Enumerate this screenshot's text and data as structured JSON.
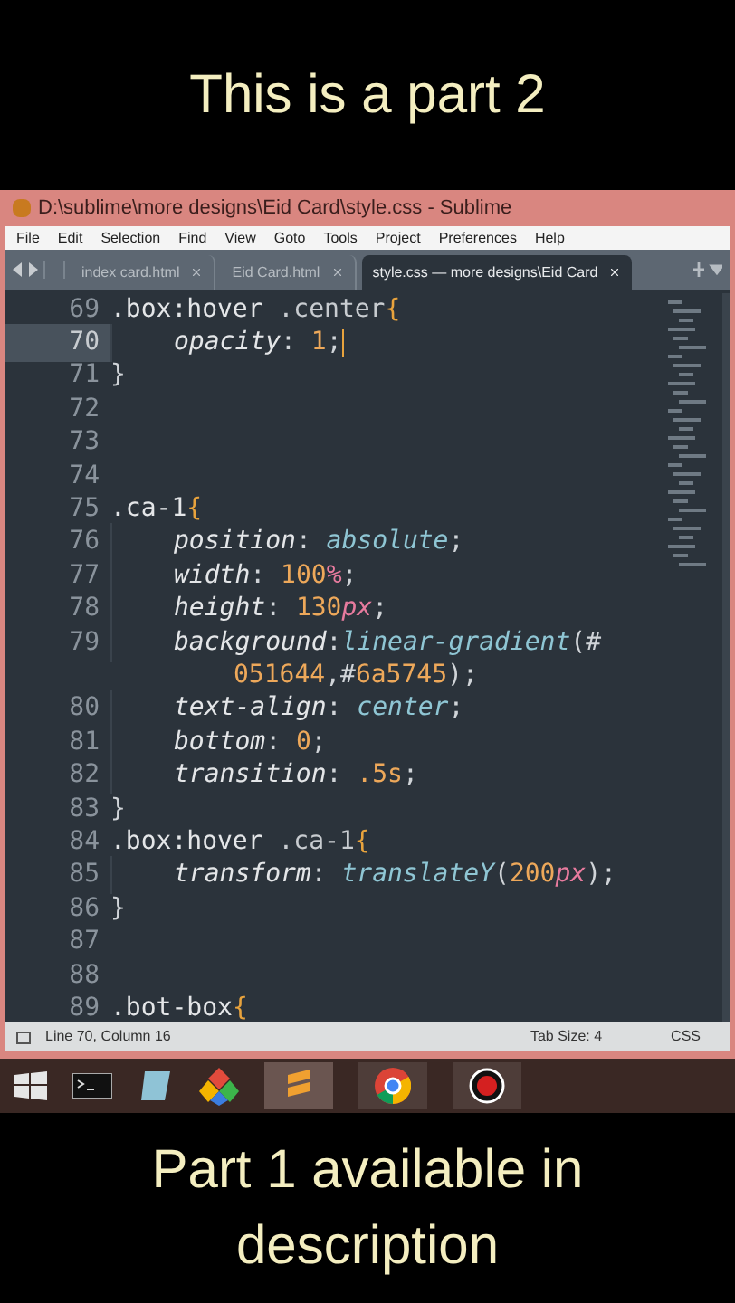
{
  "caption_top": "This is a part 2",
  "window": {
    "title": "D:\\sublime\\more designs\\Eid Card\\style.css - Sublime"
  },
  "menu": [
    "File",
    "Edit",
    "Selection",
    "Find",
    "View",
    "Goto",
    "Tools",
    "Project",
    "Preferences",
    "Help"
  ],
  "tabs": [
    {
      "label": "index card.html",
      "selected": false
    },
    {
      "label": "Eid Card.html",
      "selected": false
    },
    {
      "label": "style.css — more designs\\Eid Card",
      "selected": true
    }
  ],
  "code": [
    {
      "number": "69",
      "current": false,
      "indented": false,
      "segments": [
        {
          "text": ".box",
          "kind": "sel"
        },
        {
          "text": ":hover ",
          "kind": "sel"
        },
        {
          "text": ".center",
          "kind": "sel2"
        },
        {
          "text": "{",
          "kind": "brace"
        }
      ]
    },
    {
      "number": "70",
      "current": true,
      "indented": true,
      "segments": [
        {
          "text": "opacity",
          "kind": "prop"
        },
        {
          "text": ": ",
          "kind": "punct"
        },
        {
          "text": "1",
          "kind": "num"
        },
        {
          "text": ";",
          "kind": "punct"
        }
      ]
    },
    {
      "number": "71",
      "current": false,
      "indented": false,
      "segments": [
        {
          "text": "}",
          "kind": "punct"
        }
      ]
    },
    {
      "number": "72",
      "current": false
    },
    {
      "number": "73",
      "current": false
    },
    {
      "number": "74",
      "current": false
    },
    {
      "number": "75",
      "current": false,
      "indented": false,
      "segments": [
        {
          "text": ".ca-1",
          "kind": "sel"
        },
        {
          "text": "{",
          "kind": "brace"
        }
      ]
    },
    {
      "number": "76",
      "current": false,
      "indented": true,
      "segments": [
        {
          "text": "position",
          "kind": "prop"
        },
        {
          "text": ": ",
          "kind": "punct"
        },
        {
          "text": "absolute",
          "kind": "kw"
        },
        {
          "text": ";",
          "kind": "punct"
        }
      ]
    },
    {
      "number": "77",
      "current": false,
      "indented": true,
      "segments": [
        {
          "text": "width",
          "kind": "prop"
        },
        {
          "text": ": ",
          "kind": "punct"
        },
        {
          "text": "100",
          "kind": "num"
        },
        {
          "text": "%",
          "kind": "unit"
        },
        {
          "text": ";",
          "kind": "punct"
        }
      ]
    },
    {
      "number": "78",
      "current": false,
      "indented": true,
      "segments": [
        {
          "text": "height",
          "kind": "prop"
        },
        {
          "text": ": ",
          "kind": "punct"
        },
        {
          "text": "130",
          "kind": "num"
        },
        {
          "text": "px",
          "kind": "unit"
        },
        {
          "text": ";",
          "kind": "punct"
        }
      ]
    },
    {
      "number": "79",
      "current": false,
      "indented": true,
      "segments": [
        {
          "text": "background",
          "kind": "prop"
        },
        {
          "text": ":",
          "kind": "punct"
        },
        {
          "text": "linear-gradient",
          "kind": "fn"
        },
        {
          "text": "(#",
          "kind": "punct"
        }
      ],
      "continuation": [
        {
          "text": "051644",
          "kind": "num"
        },
        {
          "text": ",#",
          "kind": "punct"
        },
        {
          "text": "6a5745",
          "kind": "num"
        },
        {
          "text": ");",
          "kind": "punct"
        }
      ]
    },
    {
      "number": "80",
      "current": false,
      "indented": true,
      "segments": [
        {
          "text": "text-align",
          "kind": "prop"
        },
        {
          "text": ": ",
          "kind": "punct"
        },
        {
          "text": "center",
          "kind": "kw"
        },
        {
          "text": ";",
          "kind": "punct"
        }
      ]
    },
    {
      "number": "81",
      "current": false,
      "indented": true,
      "segments": [
        {
          "text": "bottom",
          "kind": "prop"
        },
        {
          "text": ": ",
          "kind": "punct"
        },
        {
          "text": "0",
          "kind": "num"
        },
        {
          "text": ";",
          "kind": "punct"
        }
      ]
    },
    {
      "number": "82",
      "current": false,
      "indented": true,
      "segments": [
        {
          "text": "transition",
          "kind": "prop"
        },
        {
          "text": ": ",
          "kind": "punct"
        },
        {
          "text": ".5s",
          "kind": "num"
        },
        {
          "text": ";",
          "kind": "punct"
        }
      ]
    },
    {
      "number": "83",
      "current": false,
      "indented": false,
      "segments": [
        {
          "text": "}",
          "kind": "punct"
        }
      ]
    },
    {
      "number": "84",
      "current": false,
      "indented": false,
      "segments": [
        {
          "text": ".box",
          "kind": "sel"
        },
        {
          "text": ":hover ",
          "kind": "sel"
        },
        {
          "text": ".ca-1",
          "kind": "sel2"
        },
        {
          "text": "{",
          "kind": "brace"
        }
      ]
    },
    {
      "number": "85",
      "current": false,
      "indented": true,
      "segments": [
        {
          "text": "transform",
          "kind": "prop"
        },
        {
          "text": ": ",
          "kind": "punct"
        },
        {
          "text": "translateY",
          "kind": "fn"
        },
        {
          "text": "(",
          "kind": "punct"
        },
        {
          "text": "200",
          "kind": "num"
        },
        {
          "text": "px",
          "kind": "unit"
        },
        {
          "text": ");",
          "kind": "punct"
        }
      ]
    },
    {
      "number": "86",
      "current": false,
      "indented": false,
      "segments": [
        {
          "text": "}",
          "kind": "punct"
        }
      ]
    },
    {
      "number": "87",
      "current": false
    },
    {
      "number": "88",
      "current": false
    },
    {
      "number": "89",
      "current": false,
      "indented": false,
      "segments": [
        {
          "text": ".bot-box",
          "kind": "sel"
        },
        {
          "text": "{",
          "kind": "brace"
        }
      ]
    }
  ],
  "status_bar": {
    "position": "Line 70, Column 16",
    "tab_size": "Tab Size: 4",
    "syntax": "CSS"
  },
  "caption_bottom": "Part 1 available in description"
}
